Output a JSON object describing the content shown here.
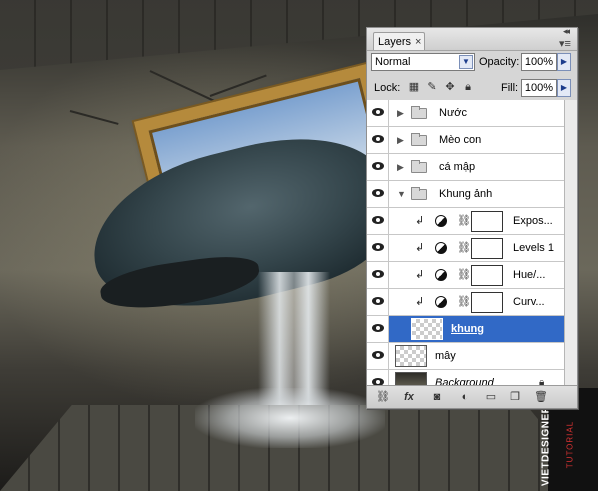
{
  "background": {
    "watermark": {
      "main": "VIETDESIGNER.NET",
      "sub": "TUTORIAL"
    }
  },
  "panel": {
    "tab_label": "Layers",
    "tab_close": "×",
    "collapse_icon": "collapse-icon",
    "menu_icon": "panel-menu-icon",
    "blend_mode": "Normal",
    "opacity_label": "Opacity:",
    "opacity_value": "100%",
    "lock_label": "Lock:",
    "fill_label": "Fill:",
    "fill_value": "100%",
    "layers": [
      {
        "name": "Nước",
        "type": "group"
      },
      {
        "name": "Mèo con",
        "type": "group"
      },
      {
        "name": "cá mập",
        "type": "group"
      },
      {
        "name": "Khung ảnh",
        "type": "group",
        "expanded": true
      },
      {
        "name": "Expos...",
        "type": "adjustment",
        "clipped": true
      },
      {
        "name": "Levels 1",
        "type": "adjustment",
        "clipped": true
      },
      {
        "name": "Hue/...",
        "type": "adjustment",
        "clipped": true
      },
      {
        "name": "Curv...",
        "type": "adjustment",
        "clipped": true
      },
      {
        "name": "khung",
        "type": "pixel",
        "selected": true
      },
      {
        "name": "mây",
        "type": "pixel"
      },
      {
        "name": "Background",
        "type": "background",
        "locked": true
      }
    ],
    "bottom_icons": [
      "link-layers-icon",
      "fx-icon",
      "add-mask-icon",
      "adjustment-layer-icon",
      "new-group-icon",
      "new-layer-icon",
      "delete-layer-icon"
    ],
    "fx_label": "fx"
  },
  "colors": {
    "selection": "#3169c6",
    "panel_bg": "#d6d6d6"
  }
}
